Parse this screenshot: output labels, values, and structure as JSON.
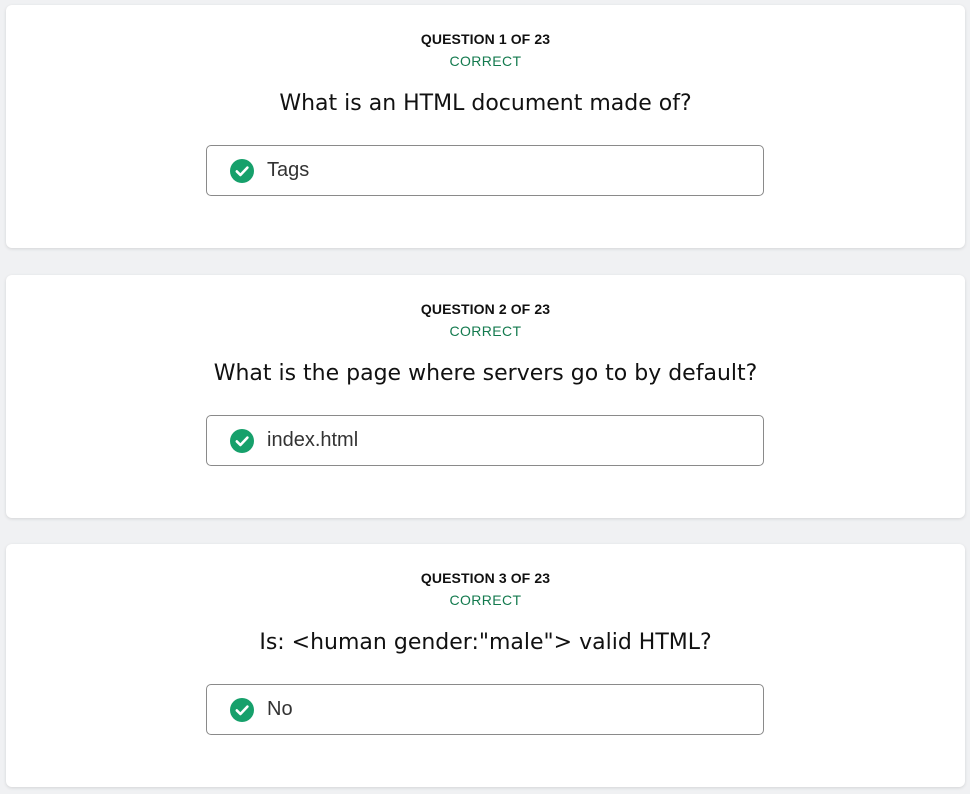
{
  "colors": {
    "accent_correct": "#137a4e",
    "check_fill": "#16a06b",
    "card_bg": "#ffffff",
    "page_bg": "#f0f1f3"
  },
  "questions": [
    {
      "counter": "QUESTION 1 OF 23",
      "status": "CORRECT",
      "question": "What is an HTML document made of?",
      "answer": "Tags",
      "answer_icon": "check-circle-icon"
    },
    {
      "counter": "QUESTION 2 OF 23",
      "status": "CORRECT",
      "question": "What is the page where servers go to by default?",
      "answer": "index.html",
      "answer_icon": "check-circle-icon"
    },
    {
      "counter": "QUESTION 3 OF 23",
      "status": "CORRECT",
      "question": "Is: <human gender:\"male\"> valid HTML?",
      "answer": "No",
      "answer_icon": "check-circle-icon"
    }
  ]
}
